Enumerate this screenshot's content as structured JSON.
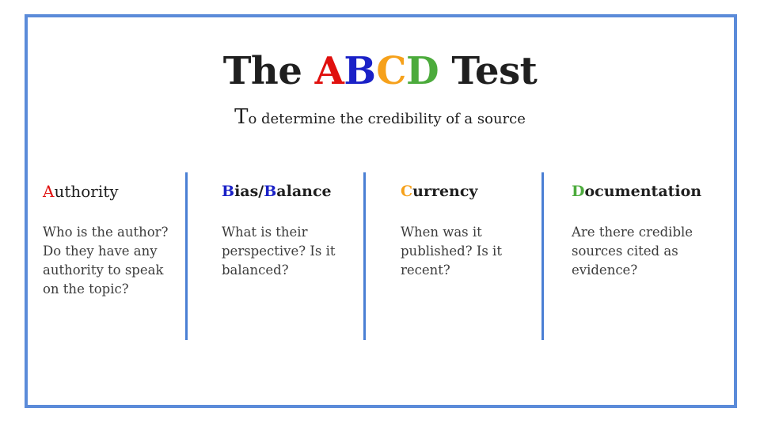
{
  "colors": {
    "frame": "#5b8bd9",
    "divider": "#4a7fd4",
    "a": "#e0100e",
    "b": "#1a21c7",
    "c": "#f6a11b",
    "d": "#4cab3c"
  },
  "title": {
    "prefix": "The ",
    "letters": [
      "A",
      "B",
      "C",
      "D"
    ],
    "suffix": " Test"
  },
  "subtitle": {
    "first_letter": "T",
    "rest": "o determine the credibility of a source"
  },
  "columns": [
    {
      "head_letter": "A",
      "head_rest": "uthority",
      "body": [
        "Who is the author?",
        "Do they have any",
        "authority to speak",
        "on the topic?"
      ]
    },
    {
      "head_letter": "B",
      "head_mid": "ias/",
      "head_letter2": "B",
      "head_rest": "alance",
      "body": [
        "What is their",
        "perspective? Is it",
        "balanced?"
      ]
    },
    {
      "head_letter": "C",
      "head_rest": "urrency",
      "body": [
        "When was it",
        "published? Is it",
        "recent?"
      ]
    },
    {
      "head_letter": "D",
      "head_rest": "ocumentation",
      "body": [
        "Are there credible",
        "sources cited as",
        "evidence?"
      ]
    }
  ]
}
